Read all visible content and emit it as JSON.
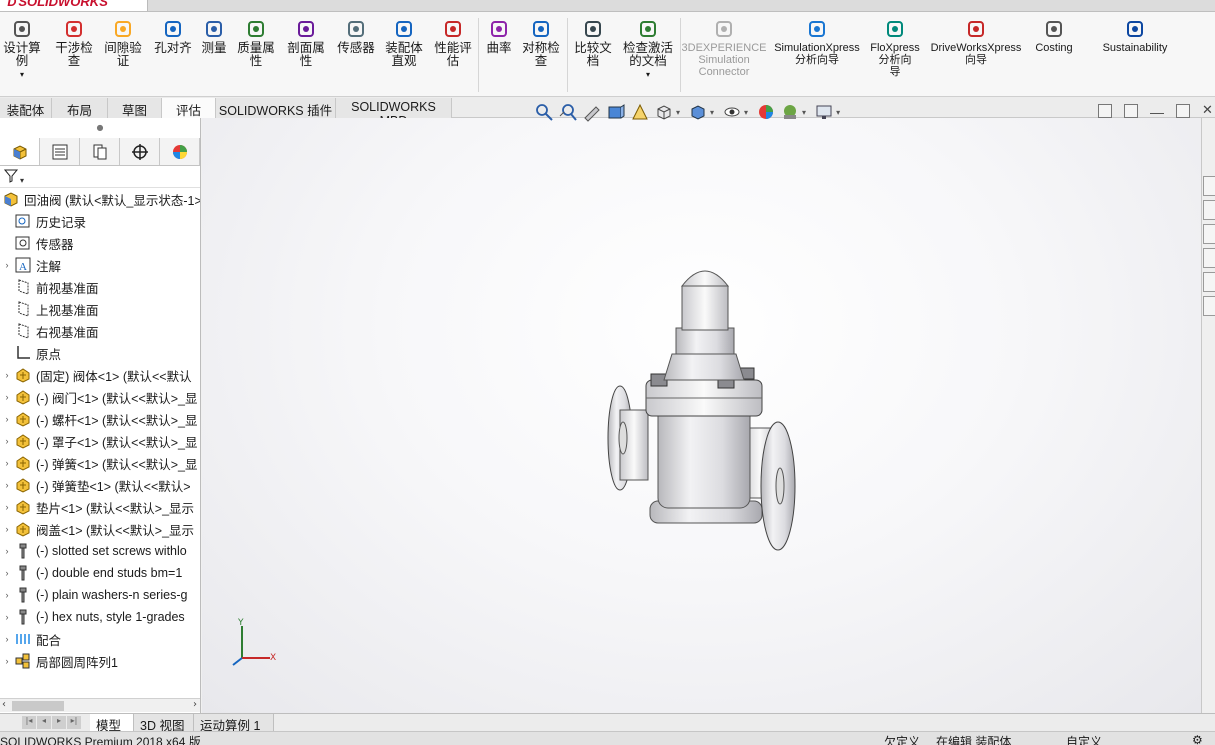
{
  "app": {
    "brand": "SOLIDWORKS",
    "status_text": "SOLIDWORKS Premium 2018 x64 版"
  },
  "command_manager": {
    "items": [
      {
        "label": "设计算\n例",
        "icon": "design-study-icon"
      },
      {
        "label": "干涉检\n查",
        "icon": "interference-detection-icon"
      },
      {
        "label": "间隙验\n证",
        "icon": "clearance-verification-icon"
      },
      {
        "label": "孔对齐",
        "icon": "hole-alignment-icon"
      },
      {
        "label": "测量",
        "icon": "measure-icon"
      },
      {
        "label": "质量属\n性",
        "icon": "mass-properties-icon"
      },
      {
        "label": "剖面属\n性",
        "icon": "section-properties-icon"
      },
      {
        "label": "传感器",
        "icon": "sensor-icon"
      },
      {
        "label": "装配体\n直观",
        "icon": "assembly-visualization-icon"
      },
      {
        "label": "性能评\n估",
        "icon": "performance-evaluation-icon"
      },
      {
        "label": "曲率",
        "icon": "curvature-icon"
      },
      {
        "label": "对称检\n查",
        "icon": "symmetry-check-icon"
      },
      {
        "label": "比较文\n档",
        "icon": "compare-documents-icon"
      },
      {
        "label": "检查激活\n的文档",
        "icon": "check-active-document-icon"
      },
      {
        "label": "3DEXPERIENCE\nSimulation\nConnector",
        "icon": "3dexperience-icon"
      },
      {
        "label": "SimulationXpress\n分析向导",
        "icon": "simulationxpress-icon"
      },
      {
        "label": "FloXpress\n分析向\n导",
        "icon": "floxpress-icon"
      },
      {
        "label": "DriveWorksXpress\n向导",
        "icon": "driveworksxpress-icon"
      },
      {
        "label": "Costing",
        "icon": "costing-icon"
      },
      {
        "label": "Sustainability",
        "icon": "sustainability-icon"
      }
    ]
  },
  "tabs": [
    "装配体",
    "布局",
    "草图",
    "评估",
    "SOLIDWORKS 插件",
    "SOLIDWORKS MBD"
  ],
  "active_tab": "评估",
  "feature_tree": {
    "root": "回油阀  (默认<默认_显示状态-1>",
    "items": [
      {
        "label": "历史记录",
        "icon": "history-icon",
        "expandable": false
      },
      {
        "label": "传感器",
        "icon": "sensor-folder-icon",
        "expandable": false
      },
      {
        "label": "注解",
        "icon": "annotations-icon",
        "expandable": true
      },
      {
        "label": "前视基准面",
        "icon": "plane-icon",
        "expandable": false
      },
      {
        "label": "上视基准面",
        "icon": "plane-icon",
        "expandable": false
      },
      {
        "label": "右视基准面",
        "icon": "plane-icon",
        "expandable": false
      },
      {
        "label": "原点",
        "icon": "origin-icon",
        "expandable": false
      },
      {
        "label": "(固定) 阀体<1> (默认<<默认",
        "icon": "part-icon",
        "expandable": true
      },
      {
        "label": "(-) 阀门<1> (默认<<默认>_显",
        "icon": "part-icon",
        "expandable": true
      },
      {
        "label": "(-) 螺杆<1> (默认<<默认>_显",
        "icon": "part-icon",
        "expandable": true
      },
      {
        "label": "(-) 罩子<1> (默认<<默认>_显",
        "icon": "part-icon",
        "expandable": true
      },
      {
        "label": "(-) 弹簧<1> (默认<<默认>_显",
        "icon": "part-icon",
        "expandable": true
      },
      {
        "label": "(-) 弹簧垫<1> (默认<<默认>",
        "icon": "part-icon",
        "expandable": true
      },
      {
        "label": "垫片<1> (默认<<默认>_显示",
        "icon": "part-icon",
        "expandable": true
      },
      {
        "label": "阀盖<1> (默认<<默认>_显示",
        "icon": "part-icon",
        "expandable": true
      },
      {
        "label": "(-) slotted set screws withlo",
        "icon": "toolbox-part-icon",
        "expandable": true
      },
      {
        "label": "(-) double end studs bm=1",
        "icon": "toolbox-part-icon",
        "expandable": true
      },
      {
        "label": "(-) plain washers-n series-g",
        "icon": "toolbox-part-icon",
        "expandable": true
      },
      {
        "label": "(-) hex nuts, style 1-grades",
        "icon": "toolbox-part-icon",
        "expandable": true
      },
      {
        "label": "配合",
        "icon": "mates-icon",
        "expandable": true
      },
      {
        "label": "局部圆周阵列1",
        "icon": "circular-pattern-icon",
        "expandable": true
      }
    ]
  },
  "bottom_tabs": [
    "模型",
    "3D 视图",
    "运动算例 1"
  ],
  "active_bottom_tab": "模型",
  "status_bar": {
    "units": "欠定义",
    "mode": "在编辑 装配体",
    "custom": "自定义"
  },
  "axis_triad": {
    "x": "X",
    "y": "Y"
  }
}
